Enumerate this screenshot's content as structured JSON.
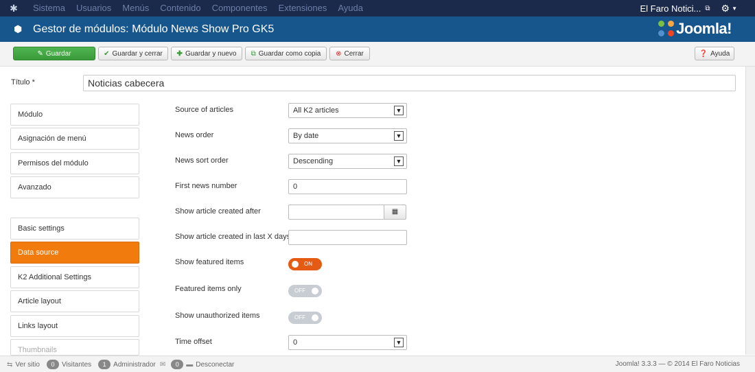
{
  "topnav": {
    "menu": [
      "Sistema",
      "Usuarios",
      "Menús",
      "Contenido",
      "Componentes",
      "Extensiones",
      "Ayuda"
    ],
    "site_name": "El Faro Notici..."
  },
  "header": {
    "title": "Gestor de módulos: Módulo News Show Pro GK5",
    "logo_text": "Joomla!"
  },
  "toolbar": {
    "save": "Guardar",
    "save_close": "Guardar y cerrar",
    "save_new": "Guardar y nuevo",
    "save_copy": "Guardar como copia",
    "close": "Cerrar",
    "help": "Ayuda"
  },
  "title_field": {
    "label": "Título *",
    "value": "Noticias cabecera"
  },
  "nav_top": [
    "Módulo",
    "Asignación de menú",
    "Permisos del módulo",
    "Avanzado"
  ],
  "nav_settings": [
    "Basic settings",
    "Data source",
    "K2 Additional Settings",
    "Article layout",
    "Links layout",
    "Thumbnails"
  ],
  "nav_active": "Data source",
  "form": {
    "source_label": "Source of articles",
    "source_value": "All K2 articles",
    "order_label": "News order",
    "order_value": "By date",
    "sort_label": "News sort order",
    "sort_value": "Descending",
    "first_label": "First news number",
    "first_value": "0",
    "after_label": "Show article created after",
    "after_value": "",
    "lastx_label": "Show article created in last X days",
    "lastx_value": "",
    "featured_label": "Show featured items",
    "featured_value": "ON",
    "featured_only_label": "Featured items only",
    "featured_only_value": "OFF",
    "unauth_label": "Show unauthorized items",
    "unauth_value": "OFF",
    "offset_label": "Time offset",
    "offset_value": "0"
  },
  "statusbar": {
    "view_site": "Ver sitio",
    "visitors_count": "0",
    "visitors_label": "Visitantes",
    "admin_count": "1",
    "admin_label": "Administrador",
    "messages_count": "0",
    "logout": "Desconectar",
    "footer": "Joomla! 3.3.3 — © 2014 El Faro Noticias"
  },
  "colors": {
    "topnav_bg": "#1b2a4a",
    "header_bg": "#17568c",
    "save_green": "#3a9a3a",
    "active_orange": "#f17b0c",
    "toggle_on": "#e55b13",
    "toggle_off": "#c7cdd3"
  },
  "icons": {
    "topnav_logo": "joomla-icon",
    "header": "cube-icon",
    "save": "edit-icon",
    "save_close": "check-icon",
    "save_new": "plus-icon",
    "save_copy": "copy-icon",
    "close": "close-icon",
    "help": "question-icon",
    "settings": "gear-icon",
    "calendar": "calendar-icon"
  }
}
